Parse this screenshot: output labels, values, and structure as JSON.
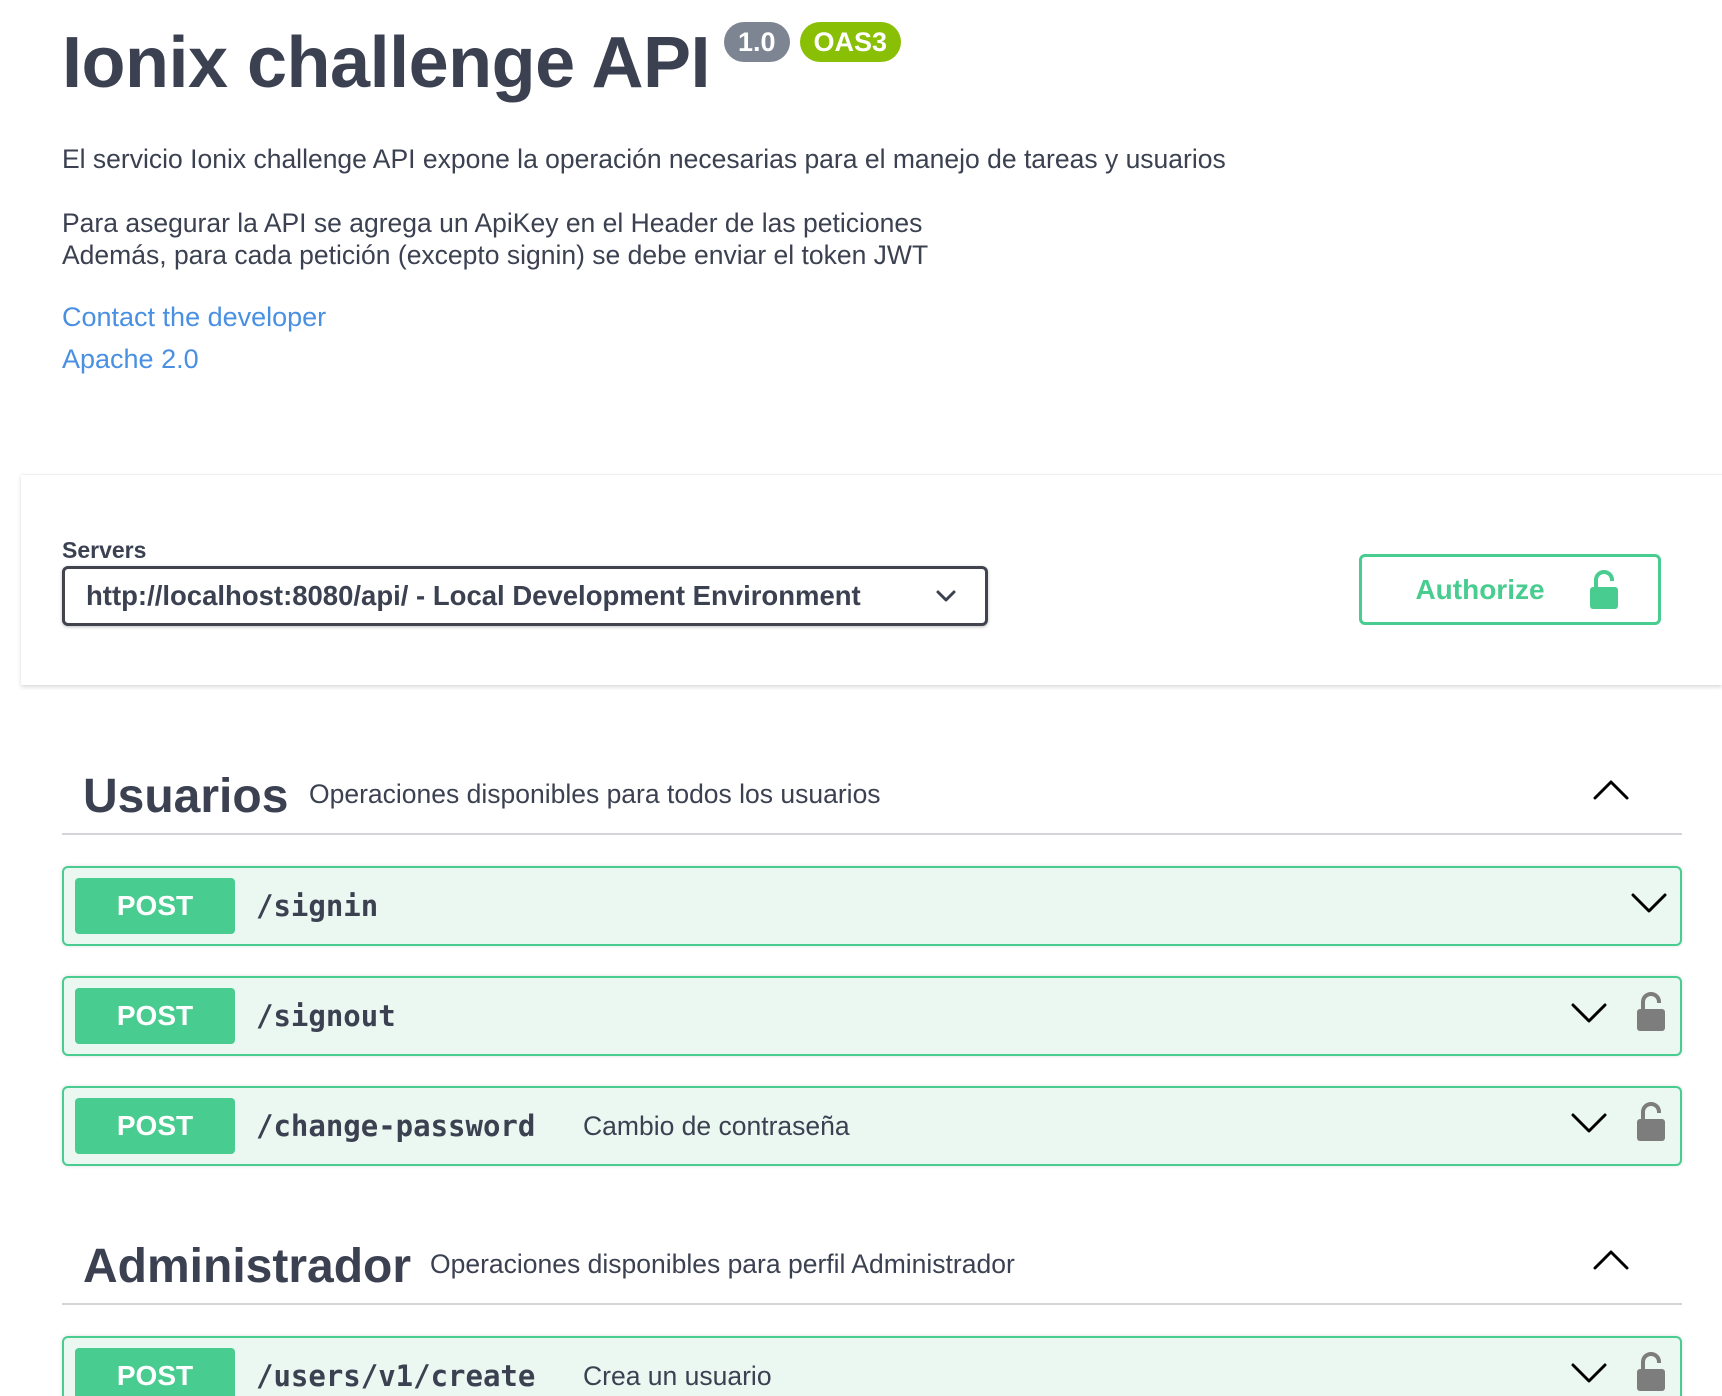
{
  "info": {
    "title": "Ionix challenge API",
    "version_badge": "1.0",
    "spec_badge": "OAS3",
    "description_line1": "El servicio Ionix challenge API expone la operación necesarias para el manejo de tareas y usuarios",
    "description_line2": "Para asegurar la API se agrega un ApiKey en el Header de las peticiones",
    "description_line3": "Además, para cada petición (excepto signin) se debe enviar el token JWT",
    "contact_link": "Contact the developer",
    "license_link": "Apache 2.0"
  },
  "scheme": {
    "servers_label": "Servers",
    "selected_server": "http://localhost:8080/api/ - Local Development Environment",
    "authorize_label": "Authorize"
  },
  "tags": [
    {
      "name": "Usuarios",
      "description": "Operaciones disponibles para todos los usuarios",
      "operations": [
        {
          "method": "POST",
          "path": "/signin",
          "summary": "",
          "locked": false
        },
        {
          "method": "POST",
          "path": "/signout",
          "summary": "",
          "locked": true
        },
        {
          "method": "POST",
          "path": "/change-password",
          "summary": "Cambio de contraseña",
          "locked": true
        }
      ]
    },
    {
      "name": "Administrador",
      "description": "Operaciones disponibles para perfil Administrador",
      "operations": [
        {
          "method": "POST",
          "path": "/users/v1/create",
          "summary": "Crea un usuario",
          "locked": true
        }
      ]
    }
  ],
  "colors": {
    "post_green": "#49cc90",
    "post_bg": "#ebf7f1",
    "link_blue": "#4990e2",
    "badge_grey": "#7d8492",
    "badge_green": "#89bf04"
  },
  "icons": {
    "select": "chevron-down-icon",
    "authorize": "unlocked-padlock-icon",
    "tag_toggle": "chevron-up-icon",
    "op_toggle": "chevron-down-icon",
    "op_lock": "padlock-icon"
  }
}
